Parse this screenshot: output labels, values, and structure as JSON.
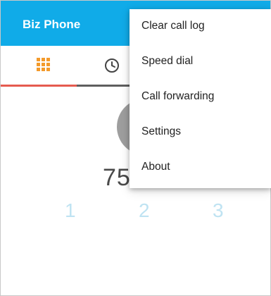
{
  "app": {
    "title": "Biz Phone",
    "accent_color": "#10abe8"
  },
  "tabs": [
    {
      "name": "dialpad",
      "icon": "dialpad-grid-icon",
      "active": true
    },
    {
      "name": "call-log",
      "icon": "clock-icon",
      "active": false
    }
  ],
  "dialer": {
    "number_visible": "75",
    "keys": [
      "1",
      "2",
      "3"
    ]
  },
  "overflow_menu": {
    "items": [
      "Clear call log",
      "Speed dial",
      "Call forwarding",
      "Settings",
      "About"
    ]
  },
  "colors": {
    "tab_indicator": "#e55b4f",
    "dialpad_icon": "#f39a2b",
    "tap_highlight": "#e85c64"
  }
}
